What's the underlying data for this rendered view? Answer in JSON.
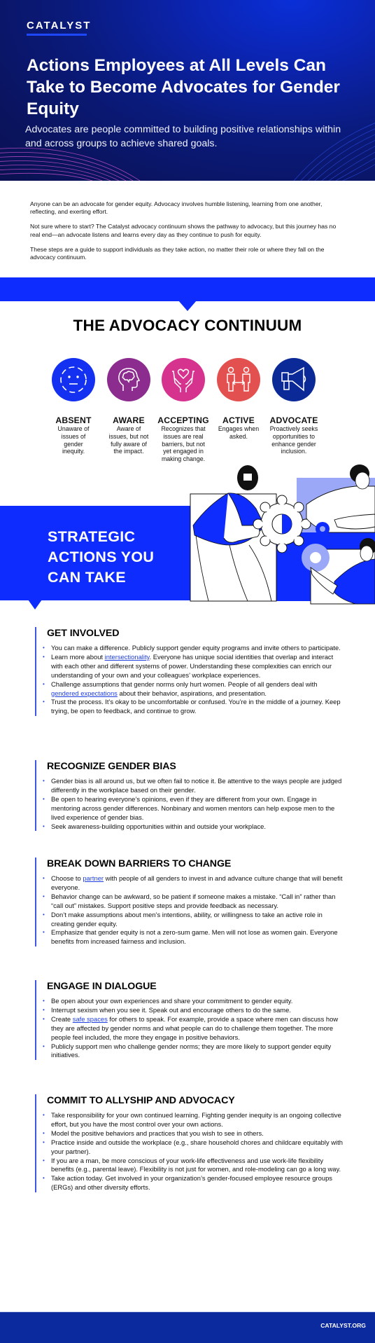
{
  "hero": {
    "logo": "CATALYST",
    "title": "Actions Employees at All Levels Can Take to Become Advocates for Gender Equity",
    "subtitle": "Advocates are people committed to building positive relationships within and across groups to achieve shared goals."
  },
  "intro": {
    "paragraphs": [
      "Anyone can be an advocate for gender equity. Advocacy involves humble listening, learning from one another, reflecting, and exerting effort.",
      "Not sure where to start? The Catalyst advocacy continuum shows the pathway to advocacy, but this journey has no real end—an advocate listens and learns every day as they continue to push for equity.",
      "These steps are a guide to support individuals as they take action, no matter their role or where they fall on the advocacy continuum."
    ]
  },
  "continuum": {
    "title": "THE ADVOCACY CONTINUUM",
    "stages": [
      {
        "name": "ABSENT",
        "desc": "Unaware of issues of gender inequity.",
        "icon": "neutral-face-icon",
        "color": "#1430f0"
      },
      {
        "name": "AWARE",
        "desc": "Aware of issues, but not fully aware of the impact.",
        "icon": "head-brain-icon",
        "color": "#8b2c8e"
      },
      {
        "name": "ACCEPTING",
        "desc": "Recognizes that issues are real barriers, but not yet engaged in making change.",
        "icon": "hands-heart-icon",
        "color": "#d6338f"
      },
      {
        "name": "ACTIVE",
        "desc": "Engages when asked.",
        "icon": "two-people-arrow-icon",
        "color": "#e2514f"
      },
      {
        "name": "ADVOCATE",
        "desc": "Proactively seeks opportunities to enhance gender inclusion.",
        "icon": "megaphone-icon",
        "color": "#0b2a98"
      }
    ]
  },
  "strategic": {
    "title": "STRATEGIC ACTIONS YOU CAN TAKE"
  },
  "sections": [
    {
      "title": "GET INVOLVED",
      "items": [
        {
          "pre": "You can make a difference. Publicly support gender equity programs and invite others to participate.",
          "link": "",
          "post": ""
        },
        {
          "pre": "Learn more about ",
          "link": "intersectionality",
          "post": ". Everyone has unique social identities that overlap and interact with each other and different systems of power. Understanding these complexities can enrich our understanding of your own and your colleagues’ workplace experiences."
        },
        {
          "pre": "Challenge assumptions that gender norms only hurt women. People of all genders deal with ",
          "link": "gendered expectations",
          "post": " about their behavior, aspirations, and presentation."
        },
        {
          "pre": "Trust the process. It’s okay to be uncomfortable or confused. You’re in the middle of a journey. Keep trying, be open to feedback, and continue to grow.",
          "link": "",
          "post": ""
        }
      ]
    },
    {
      "title": "RECOGNIZE GENDER BIAS",
      "items": [
        {
          "pre": "Gender bias is all around us, but we often fail to notice it. Be attentive to the ways people are judged differently in the workplace based on their gender.",
          "link": "",
          "post": ""
        },
        {
          "pre": "Be open to hearing everyone’s opinions, even if they are different from your own. Engage in mentoring across gender differences. Nonbinary and women mentors can help expose men to the lived experience of gender bias.",
          "link": "",
          "post": ""
        },
        {
          "pre": "Seek awareness-building opportunities within and outside your workplace.",
          "link": "",
          "post": ""
        }
      ]
    },
    {
      "title": "BREAK DOWN BARRIERS TO CHANGE",
      "items": [
        {
          "pre": "Choose to ",
          "link": "partner",
          "post": " with people of all genders to invest in and advance culture change that will benefit everyone."
        },
        {
          "pre": "Behavior change can be awkward, so be patient if someone makes a mistake. “Call in” rather than “call out” mistakes. Support positive steps and provide feedback as necessary.",
          "link": "",
          "post": ""
        },
        {
          "pre": "Don’t make assumptions about men’s intentions, ability, or willingness to take an active role in creating gender equity.",
          "link": "",
          "post": ""
        },
        {
          "pre": "Emphasize that gender equity is not a zero-sum game. Men will not lose as women gain. Everyone benefits from increased fairness and inclusion.",
          "link": "",
          "post": ""
        }
      ]
    },
    {
      "title": "ENGAGE IN DIALOGUE",
      "items": [
        {
          "pre": "Be open about your own experiences and share your commitment to gender equity.",
          "link": "",
          "post": ""
        },
        {
          "pre": "Interrupt sexism when you see it. Speak out and encourage others to do the same.",
          "link": "",
          "post": ""
        },
        {
          "pre": "Create ",
          "link": "safe spaces",
          "post": " for others to speak. For example, provide a space where men can discuss how they are affected by gender norms and what people can do to challenge them together. The more people feel included, the more they engage in positive behaviors."
        },
        {
          "pre": "Publicly support men who challenge gender norms; they are more likely to support gender equity initiatives.",
          "link": "",
          "post": ""
        }
      ]
    },
    {
      "title": "COMMIT TO ALLYSHIP AND ADVOCACY",
      "items": [
        {
          "pre": "Take responsibility for your own continued learning. Fighting gender inequity is an ongoing collective effort, but you have the most control over your own actions.",
          "link": "",
          "post": ""
        },
        {
          "pre": "Model the positive behaviors and practices that you wish to see in others.",
          "link": "",
          "post": ""
        },
        {
          "pre": "Practice inside and outside the workplace (e.g., share household chores and childcare equitably with your partner).",
          "link": "",
          "post": ""
        },
        {
          "pre": "If you are a man, be more conscious of your work-life effectiveness and use work-life flexibility benefits (e.g., parental leave). Flexibility is not just for women, and role-modeling can go a long way.",
          "link": "",
          "post": ""
        },
        {
          "pre": "Take action today. Get involved in your organization’s gender-focused employee resource groups (ERGs) and other diversity efforts.",
          "link": "",
          "post": ""
        }
      ]
    }
  ],
  "footer": {
    "link": "CATALYST.ORG"
  },
  "bullet_char": "•"
}
